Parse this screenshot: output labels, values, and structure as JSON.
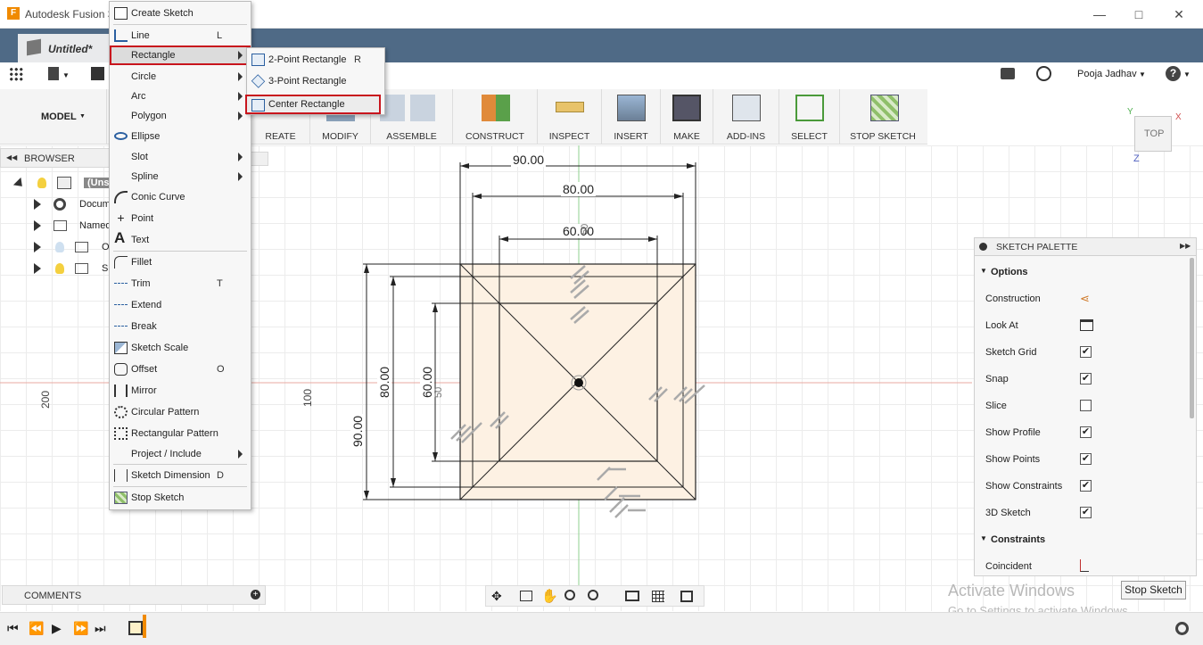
{
  "app": {
    "title": "Autodesk Fusion 3"
  },
  "document": {
    "tab_title": "Untitled*"
  },
  "user": {
    "name": "Pooja Jadhav"
  },
  "ribbon": {
    "workspace": "MODEL",
    "groups": [
      "REATE",
      "MODIFY",
      "ASSEMBLE",
      "CONSTRUCT",
      "INSPECT",
      "INSERT",
      "MAKE",
      "ADD-INS",
      "SELECT",
      "STOP SKETCH"
    ]
  },
  "browser": {
    "header": "BROWSER",
    "rows": [
      "(Uns",
      "Docum",
      "Named",
      "O",
      "S"
    ]
  },
  "comments": {
    "header": "COMMENTS"
  },
  "viewcube": {
    "face": "TOP",
    "axis_x": "X",
    "axis_y": "Y",
    "axis_z": "Z"
  },
  "rulers": {
    "left_200": "200",
    "left_100": "100"
  },
  "sketch": {
    "dim_90_top": "90.00",
    "dim_80_top": "80.00",
    "dim_60_top": "60.00",
    "dim_90_left": "90.00",
    "dim_80_left": "80.00",
    "dim_60_left": "60.00",
    "tick_50_a": "50",
    "tick_50_b": "50"
  },
  "menu": {
    "create_sketch": "Create Sketch",
    "line": "Line",
    "line_sc": "L",
    "rectangle": "Rectangle",
    "circle": "Circle",
    "arc": "Arc",
    "polygon": "Polygon",
    "ellipse": "Ellipse",
    "slot": "Slot",
    "spline": "Spline",
    "conic": "Conic Curve",
    "point": "Point",
    "text": "Text",
    "fillet": "Fillet",
    "trim": "Trim",
    "trim_sc": "T",
    "extend": "Extend",
    "break": "Break",
    "sketch_scale": "Sketch Scale",
    "offset": "Offset",
    "offset_sc": "O",
    "mirror": "Mirror",
    "circular_pattern": "Circular Pattern",
    "rect_pattern": "Rectangular Pattern",
    "project": "Project / Include",
    "sketch_dim": "Sketch Dimension",
    "sketch_dim_sc": "D",
    "stop_sketch": "Stop Sketch"
  },
  "submenu": {
    "two_point": "2-Point Rectangle",
    "two_point_sc": "R",
    "three_point": "3-Point Rectangle",
    "center": "Center Rectangle"
  },
  "palette": {
    "header": "SKETCH PALETTE",
    "options": "Options",
    "construction": "Construction",
    "look_at": "Look At",
    "sketch_grid": "Sketch Grid",
    "snap": "Snap",
    "slice": "Slice",
    "show_profile": "Show Profile",
    "show_points": "Show Points",
    "show_constraints": "Show Constraints",
    "sketch_3d": "3D Sketch",
    "constraints": "Constraints",
    "coincident": "Coincident",
    "checks": {
      "sketch_grid": true,
      "snap": true,
      "slice": false,
      "show_profile": true,
      "show_points": true,
      "show_constraints": true,
      "sketch_3d": true
    }
  },
  "stop_sketch_btn": "Stop Sketch",
  "watermark": {
    "line1": "Activate Windows",
    "line2": "Go to Settings to activate Windows."
  },
  "colors": {
    "accent_red": "#c8151d",
    "tabbar": "#4f6a86",
    "sketch_fill": "#fdf1e3"
  }
}
